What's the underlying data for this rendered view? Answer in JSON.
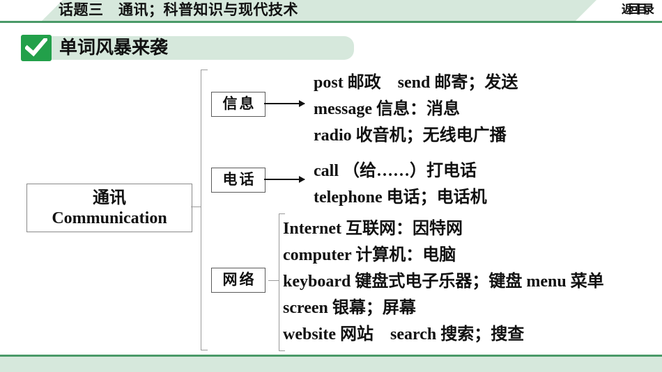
{
  "header": {
    "title": "话题三　通讯；科普知识与现代技术",
    "back_button": "返回目录",
    "bar_color": "#d6e8dc",
    "border_color": "#4a9a68"
  },
  "banner": {
    "title": "单词风暴来袭",
    "check_icon": "check-icon",
    "check_color": "#22a04a",
    "bg_color": "#d6e8dc"
  },
  "mindmap": {
    "root": {
      "cn": "通讯",
      "en": "Communication"
    },
    "branches": [
      {
        "label": "信息",
        "connector": "arrow",
        "lines": [
          "post 邮政　send 邮寄；发送",
          "message 信息：消息",
          "radio 收音机；无线电广播"
        ]
      },
      {
        "label": "电话",
        "connector": "arrow",
        "lines": [
          "call （给……）打电话",
          "telephone 电话；电话机"
        ]
      },
      {
        "label": "网络",
        "connector": "brace",
        "lines": [
          "Internet 互联网：因特网",
          "computer 计算机：电脑",
          "keyboard 键盘式电子乐器；键盘 menu 菜单　screen 银幕；屏幕",
          "website 网站　search 搜索；搜查"
        ]
      }
    ]
  },
  "footer": {
    "bg_color": "#d6e8dc",
    "border_color": "#4a9a68"
  }
}
